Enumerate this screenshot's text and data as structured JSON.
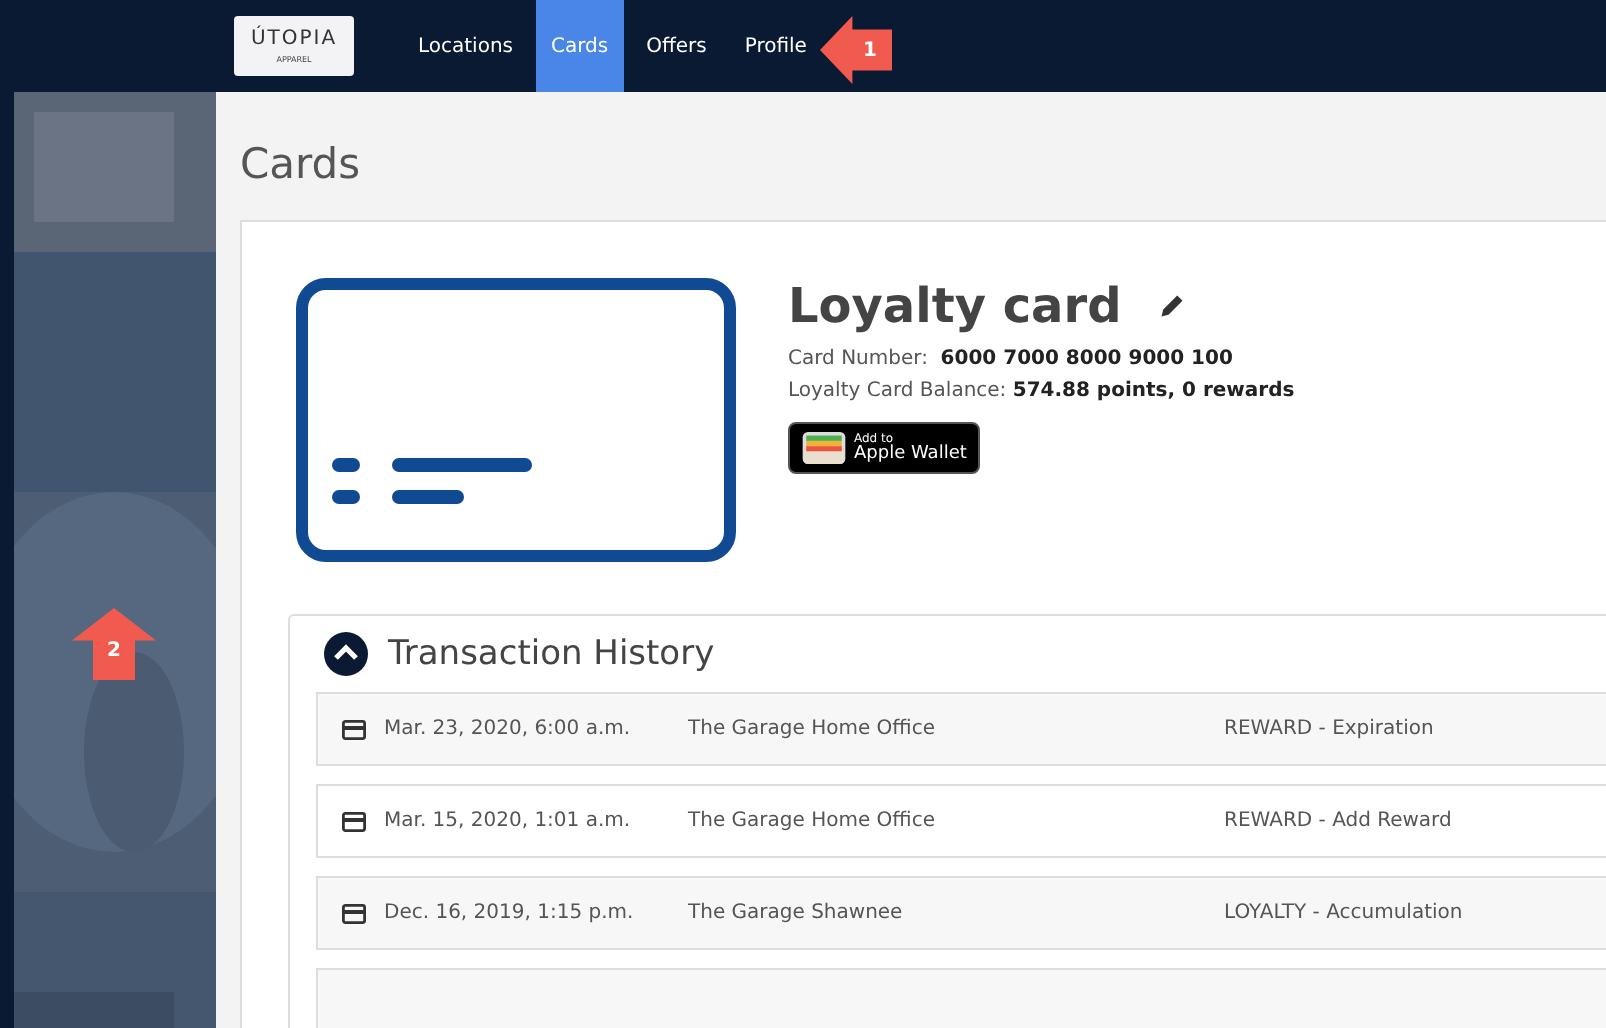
{
  "nav": {
    "logo": {
      "wordmark": "ÚTOPIA",
      "tagline": "APPAREL"
    },
    "items": [
      {
        "label": "Locations",
        "selected": false
      },
      {
        "label": "Cards",
        "selected": true
      },
      {
        "label": "Offers",
        "selected": false
      },
      {
        "label": "Profile",
        "selected": false
      }
    ]
  },
  "page_title": "Cards",
  "card": {
    "title": "Loyalty card",
    "number_label": "Card Number:",
    "number": "6000 7000 8000 9000 100",
    "balance_label": "Loyalty Card Balance:",
    "balance": "574.88 points, 0 rewards",
    "wallet": {
      "small": "Add to",
      "big": "Apple Wallet"
    }
  },
  "history": {
    "title": "Transaction History",
    "expanded": true,
    "rows": [
      {
        "date": "Mar. 23, 2020, 6:00 a.m.",
        "location": "The Garage Home Office",
        "type": "REWARD - Expiration"
      },
      {
        "date": "Mar. 15, 2020, 1:01 a.m.",
        "location": "The Garage Home Office",
        "type": "REWARD - Add Reward"
      },
      {
        "date": "Dec. 16, 2019, 1:15 p.m.",
        "location": "The Garage Shawnee",
        "type": "LOYALTY - Accumulation"
      }
    ]
  },
  "annotations": [
    {
      "label": "1",
      "kind": "left"
    },
    {
      "label": "2",
      "kind": "up"
    }
  ]
}
